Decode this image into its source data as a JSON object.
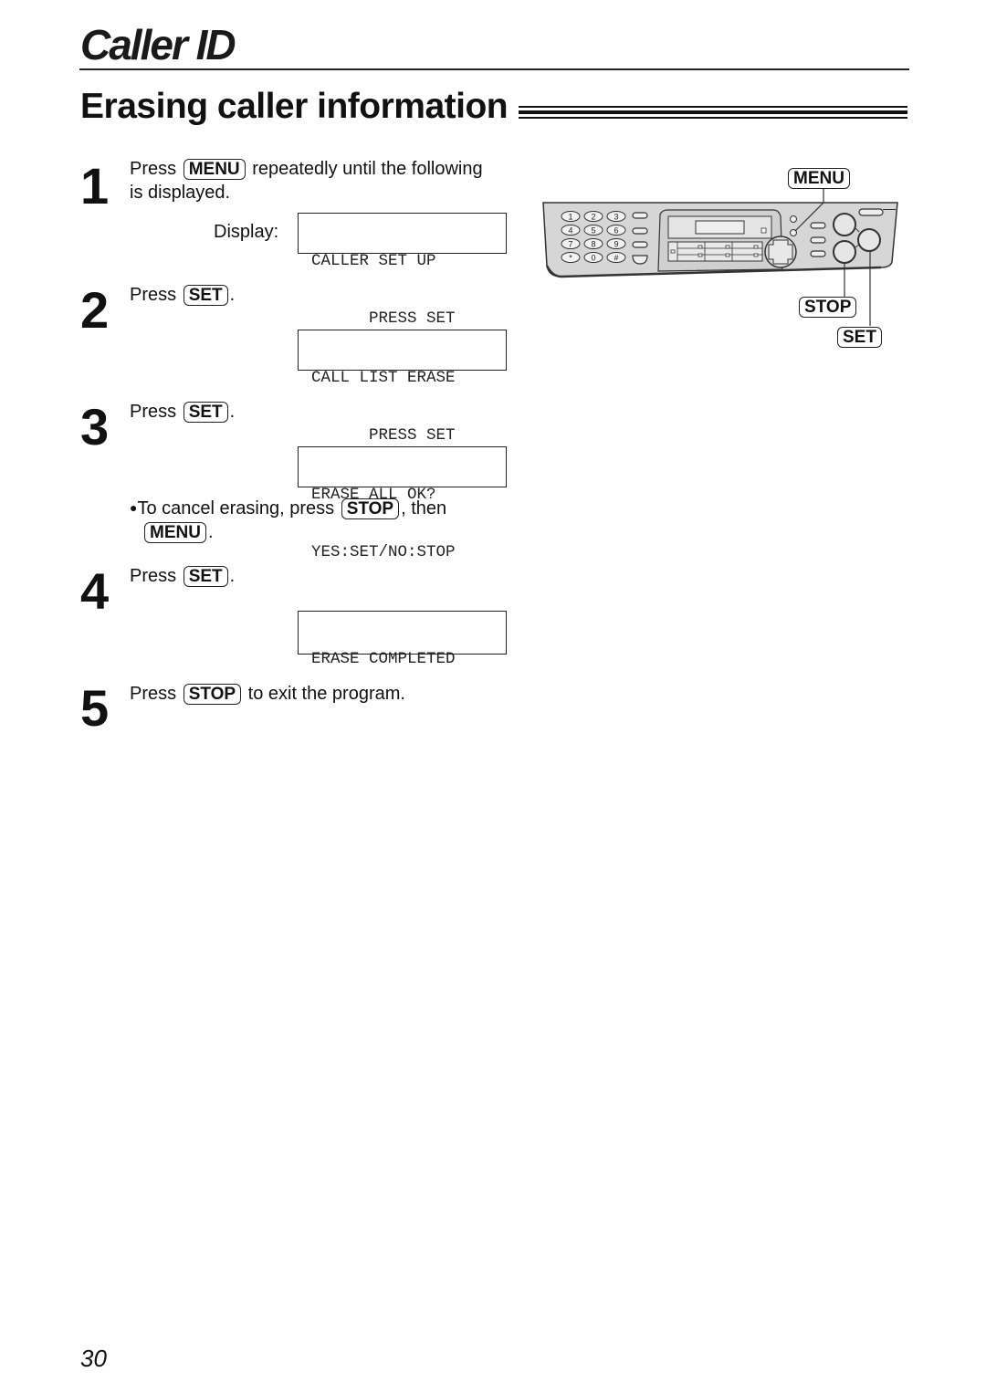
{
  "header": {
    "section_title": "Caller ID",
    "page_heading": "Erasing caller information"
  },
  "steps": [
    {
      "number": "1",
      "text_before": "Press",
      "key": "MENU",
      "text_after": "repeatedly until the following",
      "text_line2": "is displayed.",
      "display_label": "Display:",
      "display": [
        "CALLER SET UP",
        "      PRESS SET"
      ]
    },
    {
      "number": "2",
      "text_before": "Press",
      "key": "SET",
      "text_after": ".",
      "display": [
        "CALL LIST ERASE",
        "      PRESS SET"
      ]
    },
    {
      "number": "3",
      "text_before": "Press",
      "key": "SET",
      "text_after": ".",
      "display": [
        "ERASE ALL OK?",
        "YES:SET/NO:STOP"
      ],
      "note": {
        "bullet": "●",
        "text_before": "To cancel erasing, press",
        "key1": "STOP",
        "text_middle": ", then",
        "key2": "MENU",
        "text_after": "."
      }
    },
    {
      "number": "4",
      "text_before": "Press",
      "key": "SET",
      "text_after": ".",
      "display": [
        "ERASE COMPLETED",
        ""
      ]
    },
    {
      "number": "5",
      "text_before": "Press",
      "key": "STOP",
      "text_after": "to exit the program."
    }
  ],
  "illustration": {
    "callouts": {
      "menu": "MENU",
      "stop": "STOP",
      "set": "SET"
    },
    "keypad": [
      "1",
      "2",
      "3",
      "4",
      "5",
      "6",
      "7",
      "8",
      "9",
      "*",
      "0",
      "#"
    ]
  },
  "footer": {
    "page_number": "30"
  }
}
